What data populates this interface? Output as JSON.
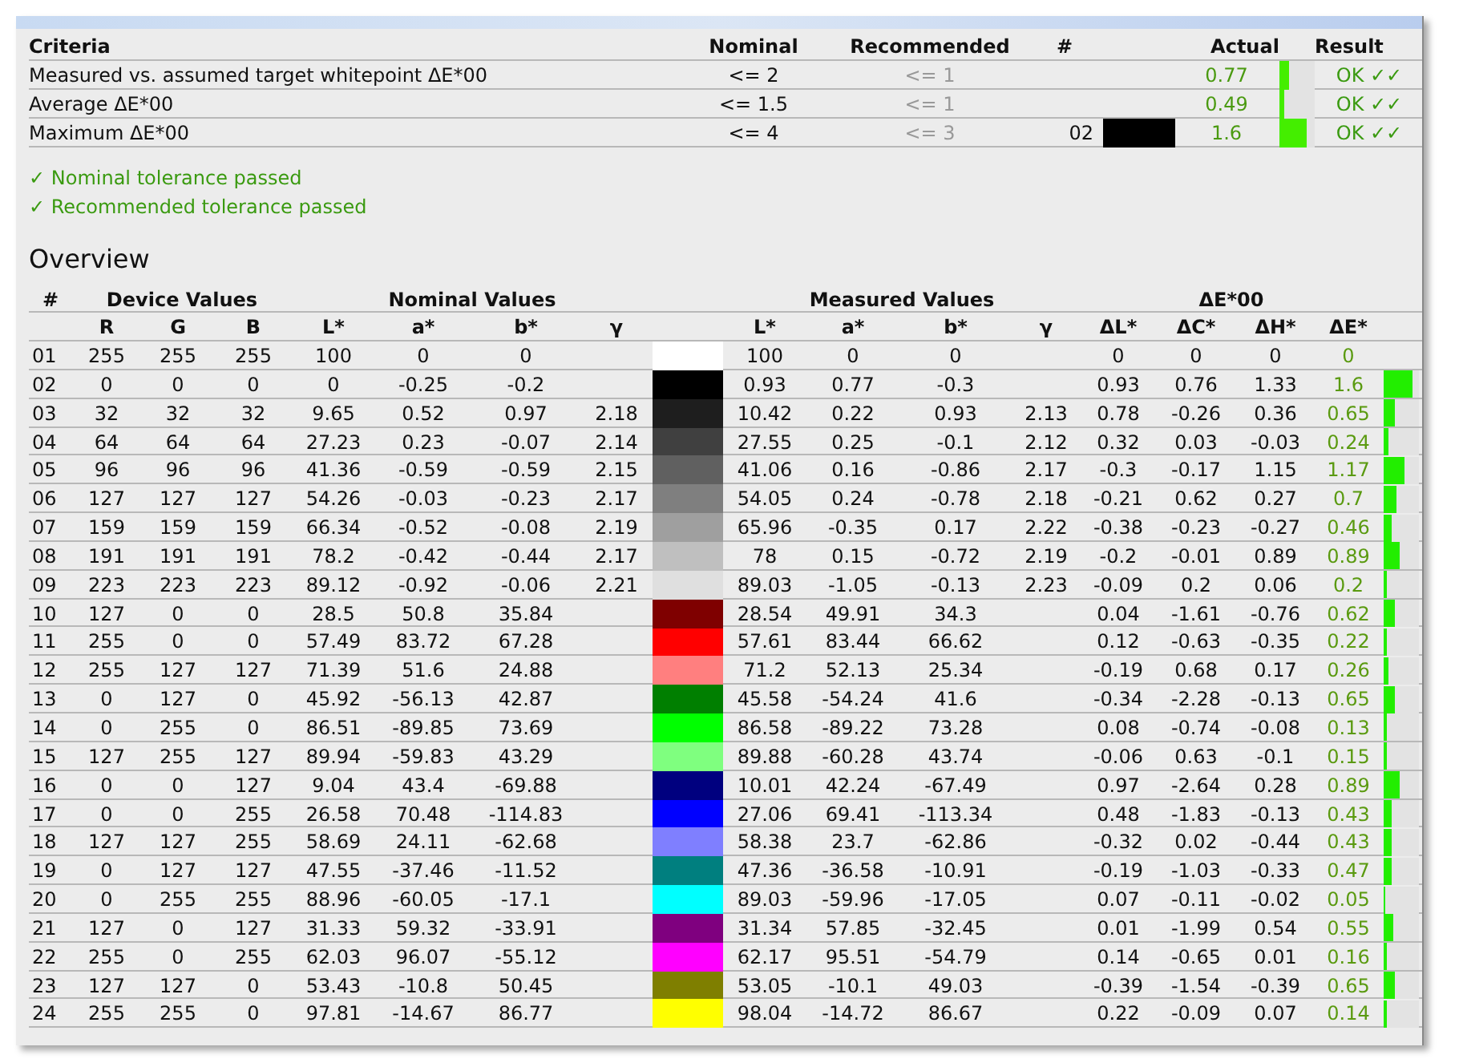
{
  "criteria": {
    "columns": [
      "Criteria",
      "Nominal",
      "Recommended",
      "#",
      "Actual",
      "Result"
    ],
    "rows": [
      {
        "criterion": "Measured vs. assumed target whitepoint ΔE*00",
        "nominal": "<= 2",
        "recommended": "<= 1",
        "actual": "0.77",
        "level": 0.25,
        "result": "OK ✓✓"
      },
      {
        "criterion": "Average ΔE*00",
        "nominal": "<= 1.5",
        "recommended": "<= 1",
        "actual": "0.49",
        "level": 0.15,
        "result": "OK ✓✓"
      },
      {
        "criterion": "Maximum ΔE*00",
        "nominal": "<= 4",
        "recommended": "<= 3",
        "patch": "02",
        "color": "#000000",
        "actual": "1.6",
        "level": 0.75,
        "result": "OK ✓✓"
      }
    ]
  },
  "notes": [
    "✓ Nominal tolerance passed",
    "✓ Recommended tolerance passed"
  ],
  "overview": {
    "title": "Overview",
    "group_headers": [
      "#",
      "Device Values",
      "Nominal Values",
      "Measured Values",
      "ΔE*00"
    ],
    "columns": [
      "R",
      "G",
      "B",
      "L*",
      "a*",
      "b*",
      "γ",
      "L*",
      "a*",
      "b*",
      "γ",
      "ΔL*",
      "ΔC*",
      "ΔH*",
      "ΔE*"
    ],
    "rows": [
      {
        "no": "01",
        "device": [
          "255",
          "255",
          "255"
        ],
        "nominal": [
          "100",
          "0",
          "0"
        ],
        "color": "#ffffff",
        "measured": [
          "100",
          "0",
          "0"
        ],
        "delta": [
          "0",
          "0",
          "0",
          "0"
        ]
      },
      {
        "no": "02",
        "device": [
          "0",
          "0",
          "0"
        ],
        "nominal": [
          "0",
          "-0.25",
          "-0.2"
        ],
        "color": "#000000",
        "measured": [
          "0.93",
          "0.77",
          "-0.3"
        ],
        "delta": [
          "0.93",
          "0.76",
          "1.33",
          "1.6"
        ],
        "level": 0.8
      },
      {
        "no": "03",
        "device": [
          "32",
          "32",
          "32"
        ],
        "nominal": [
          "9.65",
          "0.52",
          "0.97"
        ],
        "nominal_gamma": "2.18",
        "color": "#1e1e1e",
        "measured": [
          "10.42",
          "0.22",
          "0.93"
        ],
        "measured_gamma": "2.13",
        "delta": [
          "0.78",
          "-0.26",
          "0.36",
          "0.65"
        ],
        "level": 0.33
      },
      {
        "no": "04",
        "device": [
          "64",
          "64",
          "64"
        ],
        "nominal": [
          "27.23",
          "0.23",
          "-0.07"
        ],
        "nominal_gamma": "2.14",
        "color": "#404040",
        "measured": [
          "27.55",
          "0.25",
          "-0.1"
        ],
        "measured_gamma": "2.12",
        "delta": [
          "0.32",
          "0.03",
          "-0.03",
          "0.24"
        ],
        "level": 0.12
      },
      {
        "no": "05",
        "device": [
          "96",
          "96",
          "96"
        ],
        "nominal": [
          "41.36",
          "-0.59",
          "-0.59"
        ],
        "nominal_gamma": "2.15",
        "color": "#606060",
        "measured": [
          "41.06",
          "0.16",
          "-0.86"
        ],
        "measured_gamma": "2.17",
        "delta": [
          "-0.3",
          "-0.17",
          "1.15",
          "1.17"
        ],
        "level": 0.58
      },
      {
        "no": "06",
        "device": [
          "127",
          "127",
          "127"
        ],
        "nominal": [
          "54.26",
          "-0.03",
          "-0.23"
        ],
        "nominal_gamma": "2.17",
        "color": "#7f7f7f",
        "measured": [
          "54.05",
          "0.24",
          "-0.78"
        ],
        "measured_gamma": "2.18",
        "delta": [
          "-0.21",
          "0.62",
          "0.27",
          "0.7"
        ],
        "level": 0.35
      },
      {
        "no": "07",
        "device": [
          "159",
          "159",
          "159"
        ],
        "nominal": [
          "66.34",
          "-0.52",
          "-0.08"
        ],
        "nominal_gamma": "2.19",
        "color": "#9f9f9f",
        "measured": [
          "65.96",
          "-0.35",
          "0.17"
        ],
        "measured_gamma": "2.22",
        "delta": [
          "-0.38",
          "-0.23",
          "-0.27",
          "0.46"
        ],
        "level": 0.23
      },
      {
        "no": "08",
        "device": [
          "191",
          "191",
          "191"
        ],
        "nominal": [
          "78.2",
          "-0.42",
          "-0.44"
        ],
        "nominal_gamma": "2.17",
        "color": "#bfbfbf",
        "measured": [
          "78",
          "0.15",
          "-0.72"
        ],
        "measured_gamma": "2.19",
        "delta": [
          "-0.2",
          "-0.01",
          "0.89",
          "0.89"
        ],
        "level": 0.45
      },
      {
        "no": "09",
        "device": [
          "223",
          "223",
          "223"
        ],
        "nominal": [
          "89.12",
          "-0.92",
          "-0.06"
        ],
        "nominal_gamma": "2.21",
        "color": "#dfdfdf",
        "measured": [
          "89.03",
          "-1.05",
          "-0.13"
        ],
        "measured_gamma": "2.23",
        "delta": [
          "-0.09",
          "0.2",
          "0.06",
          "0.2"
        ],
        "level": 0.1
      },
      {
        "no": "10",
        "device": [
          "127",
          "0",
          "0"
        ],
        "nominal": [
          "28.5",
          "50.8",
          "35.84"
        ],
        "color": "#7f0000",
        "measured": [
          "28.54",
          "49.91",
          "34.3"
        ],
        "delta": [
          "0.04",
          "-1.61",
          "-0.76",
          "0.62"
        ],
        "level": 0.31
      },
      {
        "no": "11",
        "device": [
          "255",
          "0",
          "0"
        ],
        "nominal": [
          "57.49",
          "83.72",
          "67.28"
        ],
        "color": "#ff0000",
        "measured": [
          "57.61",
          "83.44",
          "66.62"
        ],
        "delta": [
          "0.12",
          "-0.63",
          "-0.35",
          "0.22"
        ],
        "level": 0.11
      },
      {
        "no": "12",
        "device": [
          "255",
          "127",
          "127"
        ],
        "nominal": [
          "71.39",
          "51.6",
          "24.88"
        ],
        "color": "#ff7f7f",
        "measured": [
          "71.2",
          "52.13",
          "25.34"
        ],
        "delta": [
          "-0.19",
          "0.68",
          "0.17",
          "0.26"
        ],
        "level": 0.13
      },
      {
        "no": "13",
        "device": [
          "0",
          "127",
          "0"
        ],
        "nominal": [
          "45.92",
          "-56.13",
          "42.87"
        ],
        "color": "#007f00",
        "measured": [
          "45.58",
          "-54.24",
          "41.6"
        ],
        "delta": [
          "-0.34",
          "-2.28",
          "-0.13",
          "0.65"
        ],
        "level": 0.33
      },
      {
        "no": "14",
        "device": [
          "0",
          "255",
          "0"
        ],
        "nominal": [
          "86.51",
          "-89.85",
          "73.69"
        ],
        "color": "#00ff00",
        "measured": [
          "86.58",
          "-89.22",
          "73.28"
        ],
        "delta": [
          "0.08",
          "-0.74",
          "-0.08",
          "0.13"
        ],
        "level": 0.07
      },
      {
        "no": "15",
        "device": [
          "127",
          "255",
          "127"
        ],
        "nominal": [
          "89.94",
          "-59.83",
          "43.29"
        ],
        "color": "#7fff7f",
        "measured": [
          "89.88",
          "-60.28",
          "43.74"
        ],
        "delta": [
          "-0.06",
          "0.63",
          "-0.1",
          "0.15"
        ],
        "level": 0.08
      },
      {
        "no": "16",
        "device": [
          "0",
          "0",
          "127"
        ],
        "nominal": [
          "9.04",
          "43.4",
          "-69.88"
        ],
        "color": "#00007f",
        "measured": [
          "10.01",
          "42.24",
          "-67.49"
        ],
        "delta": [
          "0.97",
          "-2.64",
          "0.28",
          "0.89"
        ],
        "level": 0.45
      },
      {
        "no": "17",
        "device": [
          "0",
          "0",
          "255"
        ],
        "nominal": [
          "26.58",
          "70.48",
          "-114.83"
        ],
        "color": "#0000ff",
        "measured": [
          "27.06",
          "69.41",
          "-113.34"
        ],
        "delta": [
          "0.48",
          "-1.83",
          "-0.13",
          "0.43"
        ],
        "level": 0.22
      },
      {
        "no": "18",
        "device": [
          "127",
          "127",
          "255"
        ],
        "nominal": [
          "58.69",
          "24.11",
          "-62.68"
        ],
        "color": "#7f7fff",
        "measured": [
          "58.38",
          "23.7",
          "-62.86"
        ],
        "delta": [
          "-0.32",
          "0.02",
          "-0.44",
          "0.43"
        ],
        "level": 0.22
      },
      {
        "no": "19",
        "device": [
          "0",
          "127",
          "127"
        ],
        "nominal": [
          "47.55",
          "-37.46",
          "-11.52"
        ],
        "color": "#007f7f",
        "measured": [
          "47.36",
          "-36.58",
          "-10.91"
        ],
        "delta": [
          "-0.19",
          "-1.03",
          "-0.33",
          "0.47"
        ],
        "level": 0.24
      },
      {
        "no": "20",
        "device": [
          "0",
          "255",
          "255"
        ],
        "nominal": [
          "88.96",
          "-60.05",
          "-17.1"
        ],
        "color": "#00ffff",
        "measured": [
          "89.03",
          "-59.96",
          "-17.05"
        ],
        "delta": [
          "0.07",
          "-0.11",
          "-0.02",
          "0.05"
        ],
        "level": 0.03
      },
      {
        "no": "21",
        "device": [
          "127",
          "0",
          "127"
        ],
        "nominal": [
          "31.33",
          "59.32",
          "-33.91"
        ],
        "color": "#7f007f",
        "measured": [
          "31.34",
          "57.85",
          "-32.45"
        ],
        "delta": [
          "0.01",
          "-1.99",
          "0.54",
          "0.55"
        ],
        "level": 0.28
      },
      {
        "no": "22",
        "device": [
          "255",
          "0",
          "255"
        ],
        "nominal": [
          "62.03",
          "96.07",
          "-55.12"
        ],
        "color": "#ff00ff",
        "measured": [
          "62.17",
          "95.51",
          "-54.79"
        ],
        "delta": [
          "0.14",
          "-0.65",
          "0.01",
          "0.16"
        ],
        "level": 0.08
      },
      {
        "no": "23",
        "device": [
          "127",
          "127",
          "0"
        ],
        "nominal": [
          "53.43",
          "-10.8",
          "50.45"
        ],
        "color": "#7f7f00",
        "measured": [
          "53.05",
          "-10.1",
          "49.03"
        ],
        "delta": [
          "-0.39",
          "-1.54",
          "-0.39",
          "0.65"
        ],
        "level": 0.33
      },
      {
        "no": "24",
        "device": [
          "255",
          "255",
          "0"
        ],
        "nominal": [
          "97.81",
          "-14.67",
          "86.77"
        ],
        "color": "#ffff00",
        "measured": [
          "98.04",
          "-14.72",
          "86.67"
        ],
        "delta": [
          "0.22",
          "-0.09",
          "0.07",
          "0.14"
        ],
        "level": 0.07
      }
    ]
  }
}
